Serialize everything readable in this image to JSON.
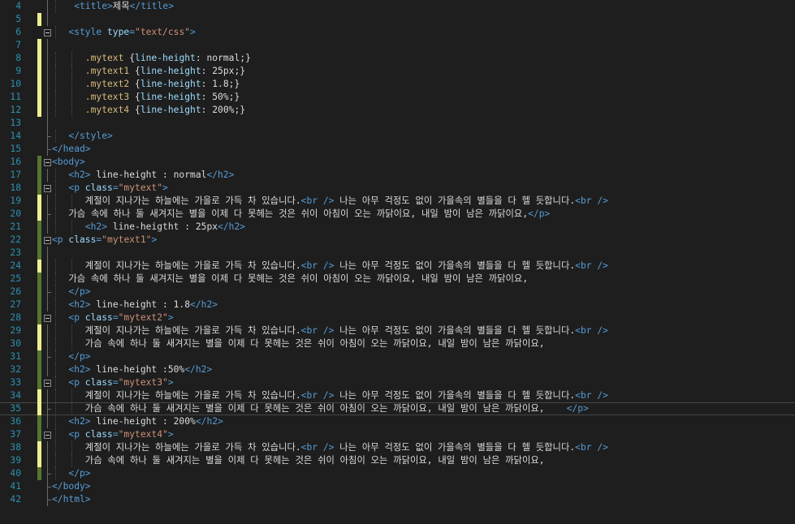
{
  "editor": {
    "lines": [
      {
        "n": "4",
        "indent": 4,
        "mark": "",
        "fold": "line",
        "tokens": [
          [
            "t",
            "<title>"
          ],
          [
            "x",
            "제목"
          ],
          [
            "t",
            "</title>"
          ]
        ]
      },
      {
        "n": "5",
        "indent": 0,
        "mark": "yellow",
        "fold": "line",
        "tokens": []
      },
      {
        "n": "6",
        "indent": 3,
        "mark": "",
        "fold": "box",
        "tokens": [
          [
            "t",
            "<style "
          ],
          [
            "a",
            "type"
          ],
          [
            "t",
            "="
          ],
          [
            "v",
            "\"text/css\""
          ],
          [
            "t",
            ">"
          ]
        ]
      },
      {
        "n": "7",
        "indent": 0,
        "mark": "yellow",
        "fold": "line",
        "tokens": []
      },
      {
        "n": "8",
        "indent": 6,
        "mark": "yellow",
        "fold": "line",
        "tokens": [
          [
            "s",
            ".mytext "
          ],
          [
            "x",
            "{"
          ],
          [
            "p",
            "line-height"
          ],
          [
            "x",
            ": normal;}"
          ]
        ]
      },
      {
        "n": "9",
        "indent": 6,
        "mark": "yellow",
        "fold": "line",
        "tokens": [
          [
            "s",
            ".mytext1 "
          ],
          [
            "x",
            "{"
          ],
          [
            "p",
            "line-height"
          ],
          [
            "x",
            ": 25px;}"
          ]
        ]
      },
      {
        "n": "10",
        "indent": 6,
        "mark": "yellow",
        "fold": "line",
        "tokens": [
          [
            "s",
            ".mytext2 "
          ],
          [
            "x",
            "{"
          ],
          [
            "p",
            "line-height"
          ],
          [
            "x",
            ": 1.8;}"
          ]
        ]
      },
      {
        "n": "11",
        "indent": 6,
        "mark": "yellow",
        "fold": "line",
        "tokens": [
          [
            "s",
            ".mytext3 "
          ],
          [
            "x",
            "{"
          ],
          [
            "p",
            "line-height"
          ],
          [
            "x",
            ": 50%;}"
          ]
        ]
      },
      {
        "n": "12",
        "indent": 6,
        "mark": "yellow",
        "fold": "line",
        "tokens": [
          [
            "s",
            ".mytext4 "
          ],
          [
            "x",
            "{"
          ],
          [
            "p",
            "line-height"
          ],
          [
            "x",
            ": 200%;}"
          ]
        ]
      },
      {
        "n": "13",
        "indent": 0,
        "mark": "",
        "fold": "line",
        "tokens": []
      },
      {
        "n": "14",
        "indent": 3,
        "mark": "",
        "fold": "end",
        "tokens": [
          [
            "t",
            "</style>"
          ]
        ]
      },
      {
        "n": "15",
        "indent": 0,
        "mark": "",
        "fold": "end",
        "tokens": [
          [
            "t",
            "</head>"
          ]
        ]
      },
      {
        "n": "16",
        "indent": 0,
        "mark": "green",
        "fold": "box",
        "tokens": [
          [
            "t",
            "<body>"
          ]
        ]
      },
      {
        "n": "17",
        "indent": 3,
        "mark": "green",
        "fold": "line",
        "tokens": [
          [
            "t",
            "<h2>"
          ],
          [
            "x",
            " line-height : normal"
          ],
          [
            "t",
            "</h2>"
          ]
        ]
      },
      {
        "n": "18",
        "indent": 3,
        "mark": "green",
        "fold": "box",
        "tokens": [
          [
            "t",
            "<p "
          ],
          [
            "a",
            "class"
          ],
          [
            "t",
            "="
          ],
          [
            "v",
            "\"mytext\""
          ],
          [
            "t",
            ">"
          ]
        ]
      },
      {
        "n": "19",
        "indent": 6,
        "mark": "yellow",
        "fold": "line",
        "tokens": [
          [
            "x",
            "계절이 지나가는 하늘에는 가을로 가득 차 있습니다."
          ],
          [
            "t",
            "<br />"
          ],
          [
            "x",
            " 나는 아무 걱정도 없이 가을속의 별들을 다 헬 듯합니다."
          ],
          [
            "t",
            "<br />"
          ]
        ]
      },
      {
        "n": "20",
        "indent": 3,
        "mark": "yellow",
        "fold": "end",
        "tokens": [
          [
            "x",
            "가슴 속에 하나 둘 새겨지는 별을 이제 다 못헤는 것은 쉬이 아침이 오는 까닭이요, 내일 밤이 남은 까닭이요,"
          ],
          [
            "t",
            "</p>"
          ]
        ]
      },
      {
        "n": "21",
        "indent": 6,
        "mark": "green",
        "fold": "line",
        "tokens": [
          [
            "t",
            "<h2>"
          ],
          [
            "x",
            " line-heigtht : 25px"
          ],
          [
            "t",
            "</h2>"
          ]
        ]
      },
      {
        "n": "22",
        "indent": 0,
        "mark": "green",
        "fold": "box",
        "tokens": [
          [
            "t",
            "<p "
          ],
          [
            "a",
            "class"
          ],
          [
            "t",
            "="
          ],
          [
            "v",
            "\"mytext1\""
          ],
          [
            "t",
            ">"
          ]
        ]
      },
      {
        "n": "23",
        "indent": 0,
        "mark": "green",
        "fold": "line",
        "tokens": []
      },
      {
        "n": "24",
        "indent": 6,
        "mark": "yellow",
        "fold": "line",
        "tokens": [
          [
            "x",
            "계절이 지나가는 하늘에는 가을로 가득 차 있습니다."
          ],
          [
            "t",
            "<br />"
          ],
          [
            "x",
            " 나는 아무 걱정도 없이 가을속의 별들을 다 헬 듯합니다."
          ],
          [
            "t",
            "<br />"
          ]
        ]
      },
      {
        "n": "25",
        "indent": 3,
        "mark": "green",
        "fold": "line",
        "tokens": [
          [
            "x",
            "가슴 속에 하나 둘 새겨지는 별을 이제 다 못헤는 것은 쉬이 아침이 오는 까닭이요, 내일 밤이 남은 까닭이요,"
          ]
        ]
      },
      {
        "n": "26",
        "indent": 3,
        "mark": "green",
        "fold": "end",
        "tokens": [
          [
            "t",
            "</p>"
          ]
        ]
      },
      {
        "n": "27",
        "indent": 3,
        "mark": "green",
        "fold": "line",
        "tokens": [
          [
            "t",
            "<h2>"
          ],
          [
            "x",
            " line-height : 1.8"
          ],
          [
            "t",
            "</h2>"
          ]
        ]
      },
      {
        "n": "28",
        "indent": 3,
        "mark": "green",
        "fold": "box",
        "tokens": [
          [
            "t",
            "<p "
          ],
          [
            "a",
            "class"
          ],
          [
            "t",
            "="
          ],
          [
            "v",
            "\"mytext2\""
          ],
          [
            "t",
            ">"
          ]
        ]
      },
      {
        "n": "29",
        "indent": 6,
        "mark": "yellow",
        "fold": "line",
        "tokens": [
          [
            "x",
            "계절이 지나가는 하늘에는 가을로 가득 차 있습니다."
          ],
          [
            "t",
            "<br />"
          ],
          [
            "x",
            " 나는 아무 걱정도 없이 가을속의 별들을 다 헬 듯합니다."
          ],
          [
            "t",
            "<br />"
          ]
        ]
      },
      {
        "n": "30",
        "indent": 6,
        "mark": "yellow",
        "fold": "line",
        "tokens": [
          [
            "x",
            "가슴 속에 하나 둘 새겨지는 별을 이제 다 못헤는 것은 쉬이 아침이 오는 까닭이요, 내일 밤이 남은 까닭이요,"
          ]
        ]
      },
      {
        "n": "31",
        "indent": 3,
        "mark": "green",
        "fold": "end",
        "tokens": [
          [
            "t",
            "</p>"
          ]
        ]
      },
      {
        "n": "32",
        "indent": 3,
        "mark": "green",
        "fold": "line",
        "tokens": [
          [
            "t",
            "<h2>"
          ],
          [
            "x",
            " line-height :50%"
          ],
          [
            "t",
            "</h2>"
          ]
        ]
      },
      {
        "n": "33",
        "indent": 3,
        "mark": "green",
        "fold": "box",
        "tokens": [
          [
            "t",
            "<p "
          ],
          [
            "a",
            "class"
          ],
          [
            "t",
            "="
          ],
          [
            "v",
            "\"mytext3\""
          ],
          [
            "t",
            ">"
          ]
        ]
      },
      {
        "n": "34",
        "indent": 6,
        "mark": "yellow",
        "fold": "line",
        "tokens": [
          [
            "x",
            "계절이 지나가는 하늘에는 가을로 가득 차 있습니다."
          ],
          [
            "t",
            "<br />"
          ],
          [
            "x",
            " 나는 아무 걱정도 없이 가을속의 별들을 다 헬 듯합니다."
          ],
          [
            "t",
            "<br />"
          ]
        ]
      },
      {
        "n": "35",
        "indent": 6,
        "mark": "yellow",
        "fold": "end",
        "current": true,
        "tokens": [
          [
            "x",
            "가슴 속에 하나 둘 새겨지는 별을 이제 다 못헤는 것은 쉬이 아침이 오는 까닭이요, 내일 밤이 남은 까닭이요,    "
          ],
          [
            "t",
            "</p>"
          ]
        ]
      },
      {
        "n": "36",
        "indent": 3,
        "mark": "green",
        "fold": "line",
        "tokens": [
          [
            "t",
            "<h2>"
          ],
          [
            "x",
            " line-height : 200%"
          ],
          [
            "t",
            "</h2>"
          ]
        ]
      },
      {
        "n": "37",
        "indent": 3,
        "mark": "green",
        "fold": "box",
        "tokens": [
          [
            "t",
            "<p "
          ],
          [
            "a",
            "class"
          ],
          [
            "t",
            "="
          ],
          [
            "v",
            "\"mytext4\""
          ],
          [
            "t",
            ">"
          ]
        ]
      },
      {
        "n": "38",
        "indent": 6,
        "mark": "yellow",
        "fold": "line",
        "tokens": [
          [
            "x",
            "계절이 지나가는 하늘에는 가을로 가득 차 있습니다."
          ],
          [
            "t",
            "<br />"
          ],
          [
            "x",
            " 나는 아무 걱정도 없이 가을속의 별들을 다 헬 듯합니다."
          ],
          [
            "t",
            "<br />"
          ]
        ]
      },
      {
        "n": "39",
        "indent": 6,
        "mark": "yellow",
        "fold": "line",
        "tokens": [
          [
            "x",
            "가슴 속에 하나 둘 새겨지는 별을 이제 다 못헤는 것은 쉬이 아침이 오는 까닭이요, 내일 밤이 남은 까닭이요,"
          ]
        ]
      },
      {
        "n": "40",
        "indent": 3,
        "mark": "green",
        "fold": "end",
        "tokens": [
          [
            "t",
            "</p>"
          ]
        ]
      },
      {
        "n": "41",
        "indent": 0,
        "mark": "",
        "fold": "end",
        "tokens": [
          [
            "t",
            "</body>"
          ]
        ]
      },
      {
        "n": "42",
        "indent": 0,
        "mark": "",
        "fold": "end",
        "tokens": [
          [
            "t",
            "</html>"
          ]
        ]
      }
    ]
  },
  "colors": {
    "background": "#1e1e1e",
    "line_number": "#2b91af",
    "tag": "#569cd6",
    "attribute": "#9cdcfe",
    "attribute_value": "#ce9178",
    "css_selector": "#d7ba7d",
    "text": "#dcdcdc",
    "change_mark_unsaved": "#efef91",
    "change_mark_saved": "#577430"
  }
}
